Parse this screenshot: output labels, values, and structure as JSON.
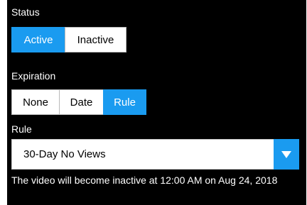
{
  "status": {
    "label": "Status",
    "options": [
      "Active",
      "Inactive"
    ],
    "selected": "Active"
  },
  "expiration": {
    "label": "Expiration",
    "options": [
      "None",
      "Date",
      "Rule"
    ],
    "selected": "Rule"
  },
  "rule": {
    "label": "Rule",
    "selected_value": "30-Day No Views"
  },
  "note": {
    "text": "The video will become inactive at 12:00 AM on Aug 24, 2018"
  },
  "colors": {
    "accent": "#1a9bf0",
    "panel_bg": "#000000",
    "button_bg": "#ffffff",
    "button_border": "#b9b9b9"
  },
  "icons": {
    "dropdown": "triangle-down-icon"
  }
}
